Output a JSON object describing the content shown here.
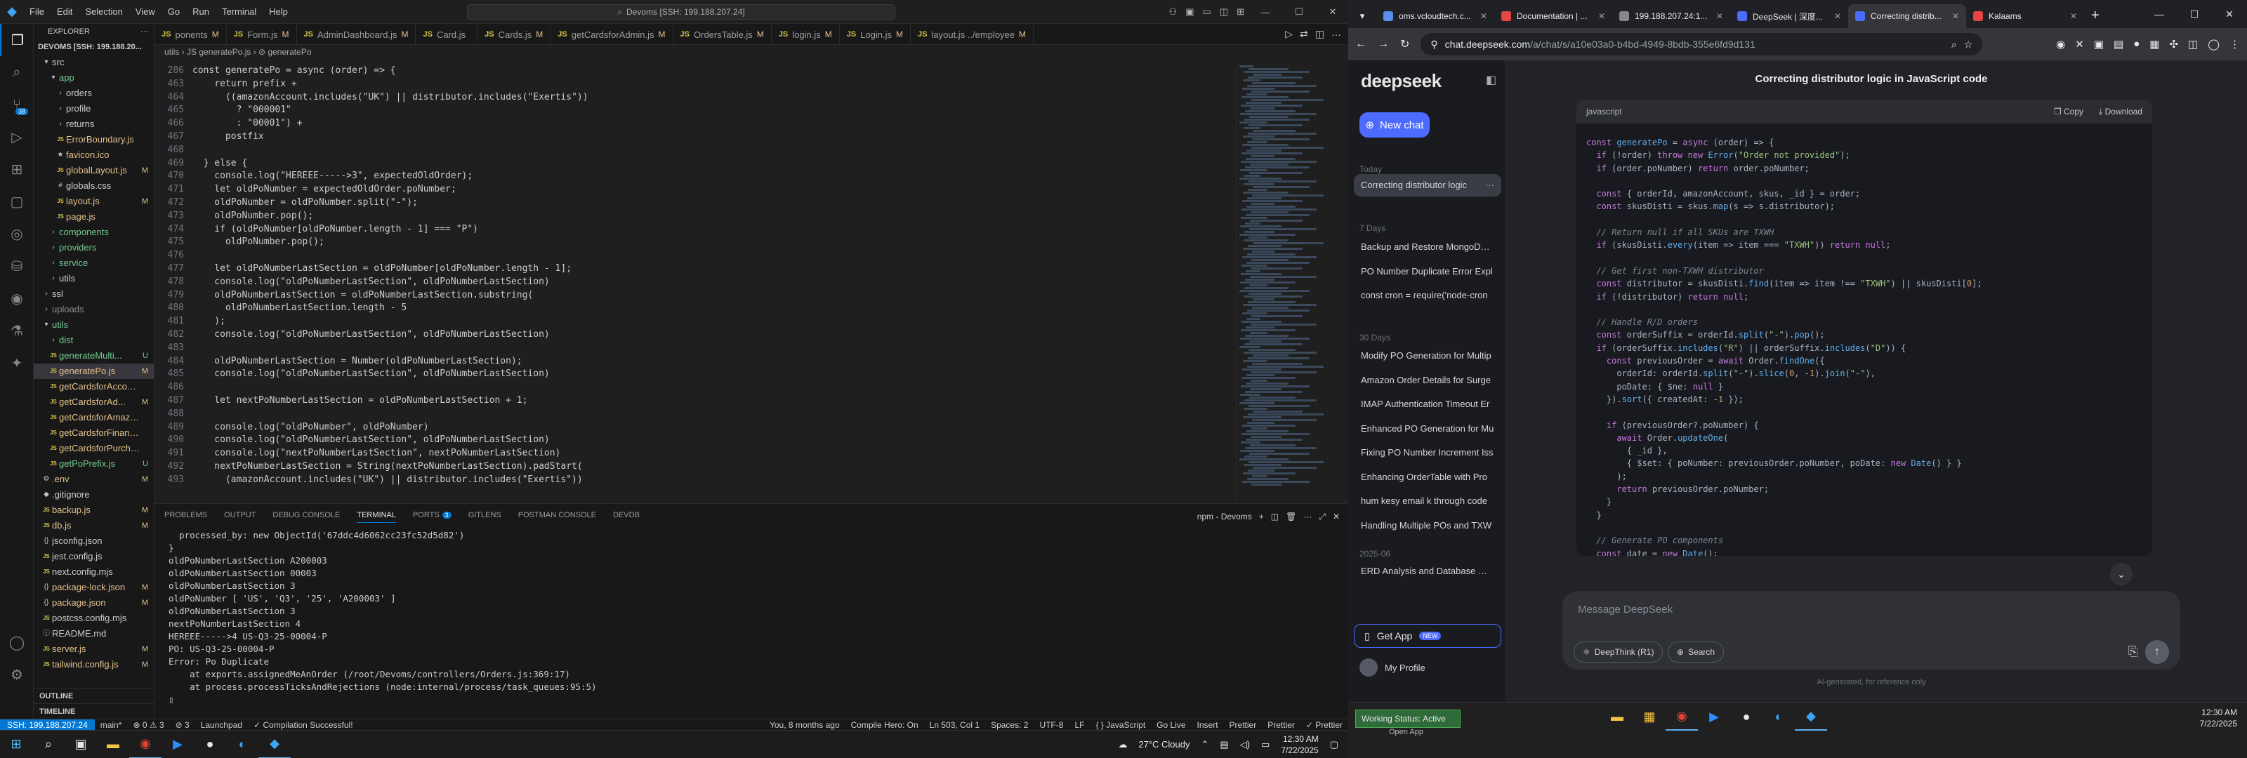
{
  "vscode": {
    "menu": [
      "File",
      "Edit",
      "Selection",
      "View",
      "Go",
      "Run",
      "Terminal",
      "Help"
    ],
    "search_text": "Devoms [SSH: 199.188.207.24]",
    "explorer_title": "EXPLORER",
    "root": "DEVOMS [SSH: 199.188.20...",
    "tree": [
      {
        "indent": 0,
        "icon": "▾",
        "label": "src",
        "cls": "c-norm",
        "badge": ""
      },
      {
        "indent": 1,
        "icon": "▾",
        "label": "app",
        "cls": "c-new",
        "badge": ""
      },
      {
        "indent": 2,
        "icon": "›",
        "label": "orders",
        "cls": "c-norm",
        "badge": ""
      },
      {
        "indent": 2,
        "icon": "›",
        "label": "profile",
        "cls": "c-norm",
        "badge": ""
      },
      {
        "indent": 2,
        "icon": "›",
        "label": "returns",
        "cls": "c-norm",
        "badge": ""
      },
      {
        "indent": 2,
        "icon": "JS",
        "label": "ErrorBoundary.js",
        "cls": "c-js",
        "badge": ""
      },
      {
        "indent": 2,
        "icon": "★",
        "label": "favicon.ico",
        "cls": "c-js",
        "badge": ""
      },
      {
        "indent": 2,
        "icon": "JS",
        "label": "globalLayout.js",
        "cls": "c-js",
        "badge": "M"
      },
      {
        "indent": 2,
        "icon": "#",
        "label": "globals.css",
        "cls": "c-norm",
        "badge": ""
      },
      {
        "indent": 2,
        "icon": "JS",
        "label": "layout.js",
        "cls": "c-js",
        "badge": "M"
      },
      {
        "indent": 2,
        "icon": "JS",
        "label": "page.js",
        "cls": "c-js",
        "badge": ""
      },
      {
        "indent": 1,
        "icon": "›",
        "label": "components",
        "cls": "c-new",
        "badge": ""
      },
      {
        "indent": 1,
        "icon": "›",
        "label": "providers",
        "cls": "c-new",
        "badge": ""
      },
      {
        "indent": 1,
        "icon": "›",
        "label": "service",
        "cls": "c-new",
        "badge": ""
      },
      {
        "indent": 1,
        "icon": "›",
        "label": "utils",
        "cls": "c-norm",
        "badge": ""
      },
      {
        "indent": 0,
        "icon": "›",
        "label": "ssl",
        "cls": "c-norm",
        "badge": ""
      },
      {
        "indent": 0,
        "icon": "›",
        "label": "uploads",
        "cls": "c-dim",
        "badge": ""
      },
      {
        "indent": 0,
        "icon": "▾",
        "label": "utils",
        "cls": "c-new",
        "badge": ""
      },
      {
        "indent": 1,
        "icon": "›",
        "label": "dist",
        "cls": "c-new",
        "badge": ""
      },
      {
        "indent": 1,
        "icon": "JS",
        "label": "generateMulti...",
        "cls": "c-new",
        "badge": "U"
      },
      {
        "indent": 1,
        "icon": "JS",
        "label": "generatePo.js",
        "cls": "c-mod",
        "badge": "M",
        "selected": true
      },
      {
        "indent": 1,
        "icon": "JS",
        "label": "getCardsforAccount.js",
        "cls": "c-js",
        "badge": ""
      },
      {
        "indent": 1,
        "icon": "JS",
        "label": "getCardsforAd...",
        "cls": "c-js",
        "badge": "M"
      },
      {
        "indent": 1,
        "icon": "JS",
        "label": "getCardsforAmazon.js",
        "cls": "c-js",
        "badge": ""
      },
      {
        "indent": 1,
        "icon": "JS",
        "label": "getCardsforFinance.js",
        "cls": "c-js",
        "badge": ""
      },
      {
        "indent": 1,
        "icon": "JS",
        "label": "getCardsforPurchasi...",
        "cls": "c-js",
        "badge": ""
      },
      {
        "indent": 1,
        "icon": "JS",
        "label": "getPoPrefix.js",
        "cls": "c-new",
        "badge": "U"
      },
      {
        "indent": 0,
        "icon": "⚙",
        "label": ".env",
        "cls": "c-js",
        "badge": "M"
      },
      {
        "indent": 0,
        "icon": "◆",
        "label": ".gitignore",
        "cls": "c-norm",
        "badge": ""
      },
      {
        "indent": 0,
        "icon": "JS",
        "label": "backup.js",
        "cls": "c-js",
        "badge": "M"
      },
      {
        "indent": 0,
        "icon": "JS",
        "label": "db.js",
        "cls": "c-js",
        "badge": "M"
      },
      {
        "indent": 0,
        "icon": "{}",
        "label": "jsconfig.json",
        "cls": "c-norm",
        "badge": ""
      },
      {
        "indent": 0,
        "icon": "JS",
        "label": "jest.config.js",
        "cls": "c-norm",
        "badge": ""
      },
      {
        "indent": 0,
        "icon": "JS",
        "label": "next.config.mjs",
        "cls": "c-norm",
        "badge": ""
      },
      {
        "indent": 0,
        "icon": "{}",
        "label": "package-lock.json",
        "cls": "c-js",
        "badge": "M"
      },
      {
        "indent": 0,
        "icon": "{}",
        "label": "package.json",
        "cls": "c-js",
        "badge": "M"
      },
      {
        "indent": 0,
        "icon": "JS",
        "label": "postcss.config.mjs",
        "cls": "c-norm",
        "badge": ""
      },
      {
        "indent": 0,
        "icon": "ⓘ",
        "label": "README.md",
        "cls": "c-norm",
        "badge": ""
      },
      {
        "indent": 0,
        "icon": "JS",
        "label": "server.js",
        "cls": "c-js",
        "badge": "M"
      },
      {
        "indent": 0,
        "icon": "JS",
        "label": "tailwind.config.js",
        "cls": "c-js",
        "badge": "M"
      }
    ],
    "outline": "OUTLINE",
    "timeline": "TIMELINE",
    "tabs": [
      {
        "label": "ponents",
        "mod": "M",
        "active": false
      },
      {
        "label": "Form.js",
        "mod": "M",
        "active": false
      },
      {
        "label": "AdminDashboard.js",
        "mod": "M",
        "active": false
      },
      {
        "label": "Card.js",
        "mod": "",
        "active": false
      },
      {
        "label": "Cards.js",
        "mod": "M",
        "active": false
      },
      {
        "label": "getCardsforAdmin.js",
        "mod": "M",
        "active": false
      },
      {
        "label": "OrdersTable.js",
        "mod": "M",
        "active": false
      },
      {
        "label": "login.js",
        "mod": "M",
        "active": false
      },
      {
        "label": "Login.js",
        "mod": "M",
        "active": false
      },
      {
        "label": "layout.js ../employee",
        "mod": "M",
        "active": false
      }
    ],
    "breadcrumb": "utils  ›  JS generatePo.js  ›  ⊘ generatePo",
    "code_lines": [
      {
        "n": "286",
        "t": "const generatePo = async (order) => {"
      },
      {
        "n": "463",
        "t": "    return prefix +"
      },
      {
        "n": "464",
        "t": "      ((amazonAccount.includes(\"UK\") || distributor.includes(\"Exertis\"))"
      },
      {
        "n": "465",
        "t": "        ? \"000001\""
      },
      {
        "n": "466",
        "t": "        : \"00001\") +"
      },
      {
        "n": "467",
        "t": "      postfix"
      },
      {
        "n": "468",
        "t": ""
      },
      {
        "n": "469",
        "t": "  } else {"
      },
      {
        "n": "470",
        "t": "    console.log(\"HEREEE----->3\", expectedOldOrder);"
      },
      {
        "n": "471",
        "t": "    let oldPoNumber = expectedOldOrder.poNumber;"
      },
      {
        "n": "472",
        "t": "    oldPoNumber = oldPoNumber.split(\"-\");"
      },
      {
        "n": "473",
        "t": "    oldPoNumber.pop();"
      },
      {
        "n": "474",
        "t": "    if (oldPoNumber[oldPoNumber.length - 1] === \"P\")"
      },
      {
        "n": "475",
        "t": "      oldPoNumber.pop();"
      },
      {
        "n": "476",
        "t": ""
      },
      {
        "n": "477",
        "t": "    let oldPoNumberLastSection = oldPoNumber[oldPoNumber.length - 1];"
      },
      {
        "n": "478",
        "t": "    console.log(\"oldPoNumberLastSection\", oldPoNumberLastSection)"
      },
      {
        "n": "479",
        "t": "    oldPoNumberLastSection = oldPoNumberLastSection.substring("
      },
      {
        "n": "480",
        "t": "      oldPoNumberLastSection.length - 5"
      },
      {
        "n": "481",
        "t": "    );"
      },
      {
        "n": "482",
        "t": "    console.log(\"oldPoNumberLastSection\", oldPoNumberLastSection)"
      },
      {
        "n": "483",
        "t": ""
      },
      {
        "n": "484",
        "t": "    oldPoNumberLastSection = Number(oldPoNumberLastSection);"
      },
      {
        "n": "485",
        "t": "    console.log(\"oldPoNumberLastSection\", oldPoNumberLastSection)"
      },
      {
        "n": "486",
        "t": ""
      },
      {
        "n": "487",
        "t": "    let nextPoNumberLastSection = oldPoNumberLastSection + 1;"
      },
      {
        "n": "488",
        "t": ""
      },
      {
        "n": "489",
        "t": "    console.log(\"oldPoNumber\", oldPoNumber)"
      },
      {
        "n": "490",
        "t": "    console.log(\"oldPoNumberLastSection\", oldPoNumberLastSection)"
      },
      {
        "n": "491",
        "t": "    console.log(\"nextPoNumberLastSection\", nextPoNumberLastSection)"
      },
      {
        "n": "492",
        "t": "    nextPoNumberLastSection = String(nextPoNumberLastSection).padStart("
      },
      {
        "n": "493",
        "t": "      (amazonAccount.includes(\"UK\") || distributor.includes(\"Exertis\"))"
      }
    ],
    "panel_tabs": [
      "PROBLEMS",
      "OUTPUT",
      "DEBUG CONSOLE",
      "TERMINAL",
      "PORTS",
      "GITLENS",
      "POSTMAN CONSOLE",
      "DEVDB"
    ],
    "ports_count": "3",
    "terminal_name": "npm - Devoms",
    "terminal_lines": [
      "  processed_by: new ObjectId('67ddc4d6062cc23fc52d5d82')",
      "}",
      "oldPoNumberLastSection A200003",
      "oldPoNumberLastSection 00003",
      "oldPoNumberLastSection 3",
      "oldPoNumber [ 'US', 'Q3', '25', 'A200003' ]",
      "oldPoNumberLastSection 3",
      "nextPoNumberLastSection 4",
      "HEREEE----->4 US-Q3-25-00004-P",
      "PO: US-Q3-25-00004-P",
      "Error: Po Duplicate",
      "    at exports.assignedMeAnOrder (/root/Devoms/controllers/Orders.js:369:17)",
      "    at process.processTicksAndRejections (node:internal/process/task_queues:95:5)",
      "▯"
    ],
    "status_left": [
      "SSH: 199.188.207.24",
      "main*",
      "⊗ 0 ⚠ 3",
      "⊘ 3",
      "Launchpad",
      "✓ Compilation Successful!"
    ],
    "status_right": [
      "You, 8 months ago",
      "Compile Hero: On",
      "Ln 503, Col 1",
      "Spaces: 2",
      "UTF-8",
      "LF",
      "{ } JavaScript",
      "Go Live",
      "Insert",
      "Prettier",
      "Prettier",
      "✓ Prettier"
    ]
  },
  "chrome": {
    "tabs": [
      {
        "title": "oms.vcloudtech.c...",
        "color": "#5b8def",
        "active": false
      },
      {
        "title": "Documentation | ...",
        "color": "#e84545",
        "active": false
      },
      {
        "title": "199.188.207.24:1...",
        "color": "#888888",
        "active": false
      },
      {
        "title": "DeepSeek | 深度...",
        "color": "#4d6bfe",
        "active": false
      },
      {
        "title": "Correcting distrib...",
        "color": "#4d6bfe",
        "active": true
      },
      {
        "title": "Kalaams",
        "color": "#e84545",
        "active": false
      }
    ],
    "url_host": "chat.deepseek.com",
    "url_path": "/a/chat/s/a10e03a0-b4bd-4949-8bdb-355e6fd9d131"
  },
  "deepseek": {
    "logo": "deepseek",
    "new_chat": "New chat",
    "sections": {
      "today": "Today",
      "days7": "7 Days",
      "days30": "30 Days",
      "month": "2025-06"
    },
    "today_chats": [
      "Correcting distributor logic"
    ],
    "week_chats": [
      "Backup and Restore MongoDB L",
      "PO Number Duplicate Error Expl",
      "const cron = require('node-cron"
    ],
    "month_chats": [
      "Modify PO Generation for Multip",
      "Amazon Order Details for Surge",
      "IMAP Authentication Timeout Er",
      "Enhanced PO Generation for Mu",
      "Fixing PO Number Increment Iss",
      "Enhancing OrderTable with Pro",
      "hum kesy email k through code",
      "Handling Multiple POs and TXW"
    ],
    "june_chats": [
      "ERD Analysis and Database Mod"
    ],
    "get_app": "Get App",
    "new_badge": "NEW",
    "profile": "My Profile",
    "title": "Correcting distributor logic in JavaScript code",
    "code_lang": "javascript",
    "copy": "Copy",
    "download": "Download",
    "placeholder": "Message DeepSeek",
    "deepthink": "DeepThink (R1)",
    "search": "Search",
    "ai_note": "AI-generated, for reference only"
  },
  "taskbar": {
    "weather": "27°C  Cloudy",
    "time": "12:30 AM",
    "date": "7/22/2025",
    "work_status": "Working Status: Active",
    "open_app": "Open App"
  }
}
